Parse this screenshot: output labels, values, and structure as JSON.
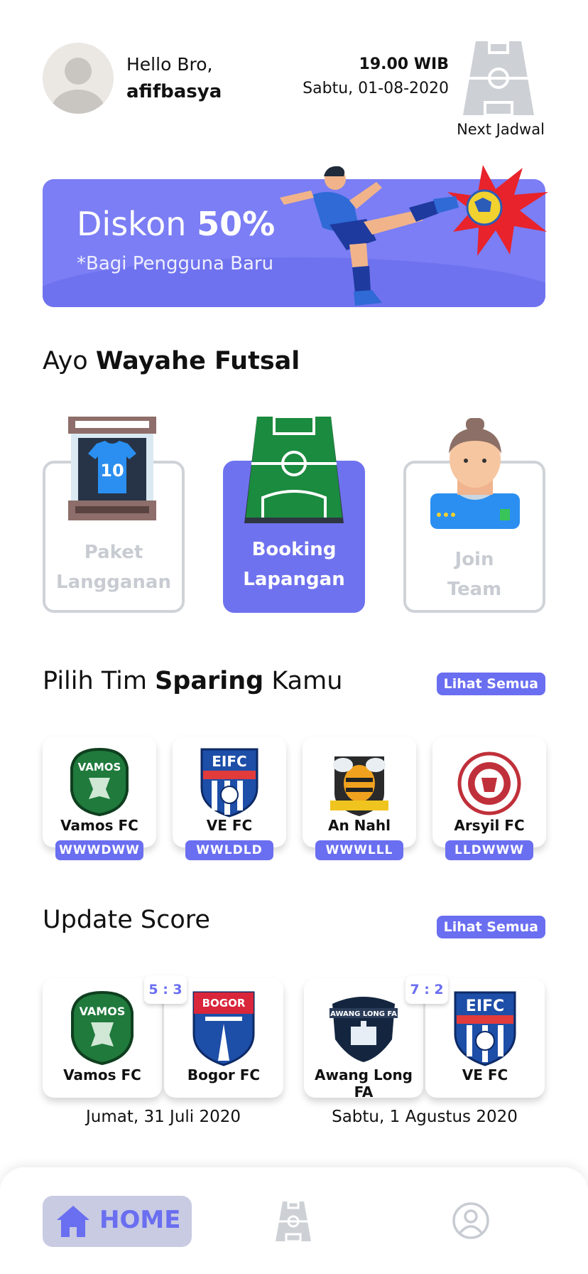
{
  "header": {
    "greeting": "Hello Bro,",
    "username": "afifbasya",
    "time": "19.00 WIB",
    "date": "Sabtu, 01-08-2020",
    "next_label": "Next Jadwal"
  },
  "banner": {
    "title_prefix": "Diskon ",
    "title_bold": "50%",
    "subtitle": "*Bagi Pengguna Baru"
  },
  "section_menu": {
    "prefix": "Ayo ",
    "bold": "Wayahe Futsal"
  },
  "menu": [
    {
      "line1": "Paket",
      "line2": "Langganan",
      "icon": "jersey-frame-icon"
    },
    {
      "line1": "Booking",
      "line2": "Lapangan",
      "icon": "futsal-field-icon"
    },
    {
      "line1": "Join",
      "line2": "Team",
      "icon": "player-icon"
    }
  ],
  "section_sparing": {
    "prefix": "Pilih Tim ",
    "bold": "Sparing",
    "suffix": " Kamu",
    "see_all": "Lihat Semua"
  },
  "teams": [
    {
      "name": "Vamos FC",
      "form": "WWWDWW",
      "logo": "vamos-logo"
    },
    {
      "name": "VE FC",
      "form": "WWLDLD",
      "logo": "eifc-logo"
    },
    {
      "name": "An Nahl",
      "form": "WWWLLL",
      "logo": "annahl-logo"
    },
    {
      "name": "Arsyil FC",
      "form": "LLDWWW",
      "logo": "arsyil-logo"
    }
  ],
  "section_score": {
    "title": "Update Score",
    "see_all": "Lihat Semua"
  },
  "matches": [
    {
      "home": "Vamos FC",
      "away": "Bogor FC",
      "score": "5 : 3",
      "date": "Jumat, 31 Juli 2020"
    },
    {
      "home": "Awang Long FA",
      "away": "VE FC",
      "score": "7 : 2",
      "date": "Sabtu, 1 Agustus 2020"
    }
  ],
  "nav": {
    "home_label": "HOME"
  },
  "colors": {
    "accent": "#6a6ef0",
    "banner": "#7b7ef4",
    "muted": "#c8ccd2"
  }
}
